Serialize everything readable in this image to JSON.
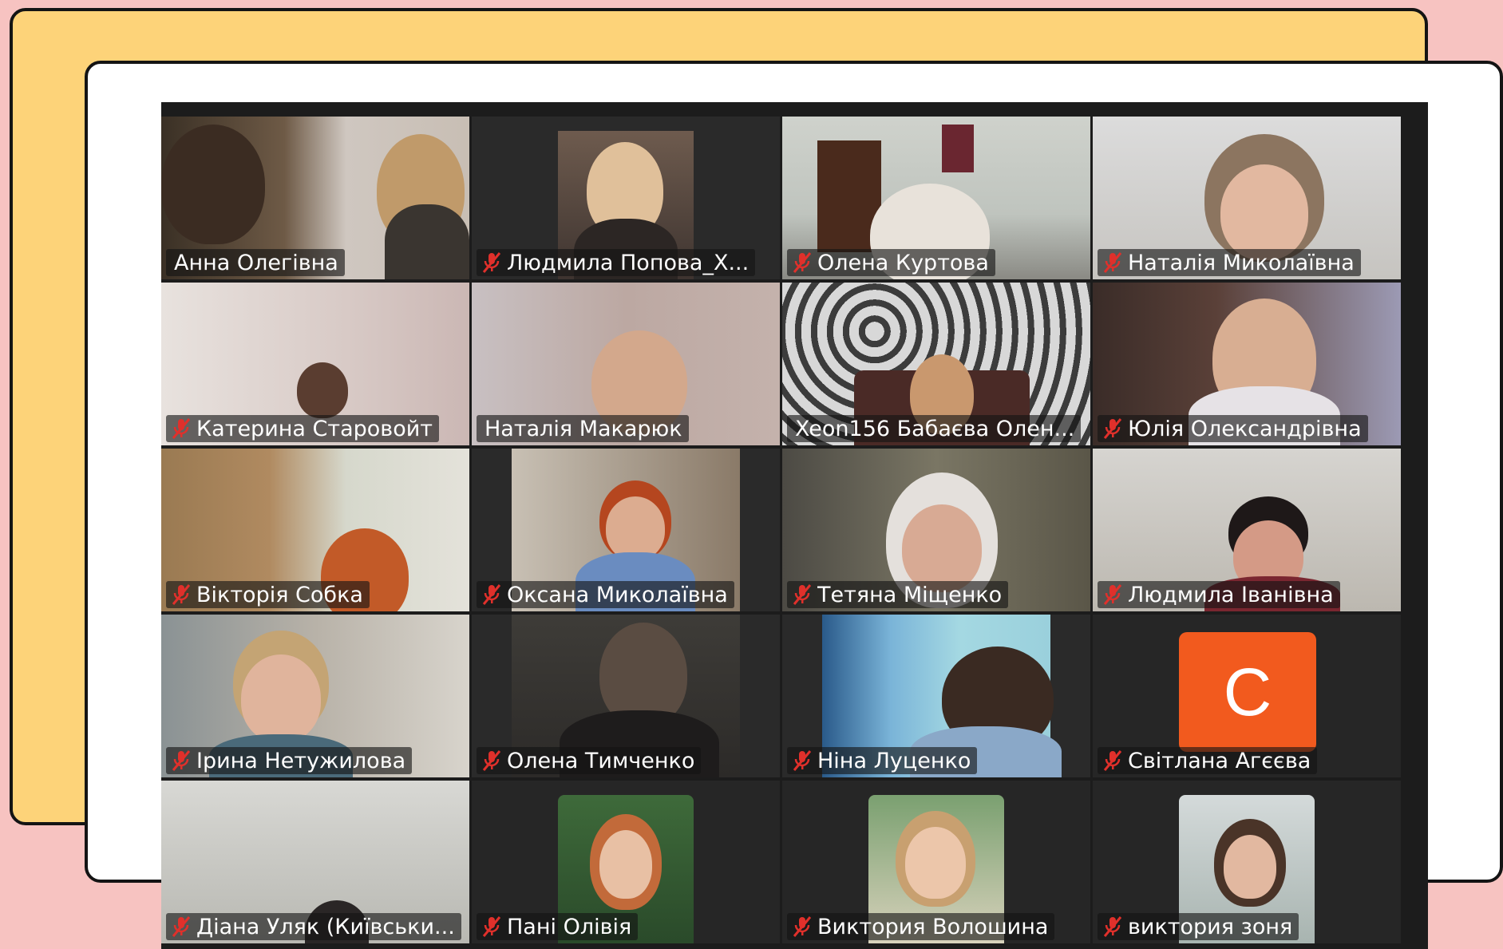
{
  "colors": {
    "page_background": "#f7c3c1",
    "back_card": "#fdd379",
    "front_card": "#ffffff",
    "meeting_background": "#1c1c1c",
    "active_speaker_border": "#23d160",
    "muted_icon": "#e0302b",
    "avatar_orange": "#f25a1e"
  },
  "meeting": {
    "participants": [
      {
        "name": "Анна Олегівна",
        "muted": false,
        "active_speaker": true
      },
      {
        "name": "Людмила Попова_Х...",
        "muted": true
      },
      {
        "name": "Олена Куртова",
        "muted": true
      },
      {
        "name": "Наталія Миколаївна",
        "muted": true
      },
      {
        "name": "Катерина Старовойт",
        "muted": true
      },
      {
        "name": "Наталія Макарюк",
        "muted": false
      },
      {
        "name": "Xeon156 Бабаєва Олен...",
        "muted": false
      },
      {
        "name": "Юлія Олександрівна",
        "muted": true
      },
      {
        "name": "Вікторія Собка",
        "muted": true
      },
      {
        "name": "Оксана Миколаївна",
        "muted": true
      },
      {
        "name": "Тетяна Міщенко",
        "muted": true
      },
      {
        "name": "Людмила Іванівна",
        "muted": true
      },
      {
        "name": "Ірина Нетужилова",
        "muted": true
      },
      {
        "name": "Олена Тимченко",
        "muted": true
      },
      {
        "name": "Ніна Луценко",
        "muted": true
      },
      {
        "name": "Світлана Агєєва",
        "muted": true,
        "avatar_letter": "С"
      },
      {
        "name": "Діана Уляк (Київськи...",
        "muted": true
      },
      {
        "name": "Пані Олівія",
        "muted": true
      },
      {
        "name": "Виктория Волошина",
        "muted": true
      },
      {
        "name": "виктория зоня",
        "muted": true
      }
    ]
  }
}
